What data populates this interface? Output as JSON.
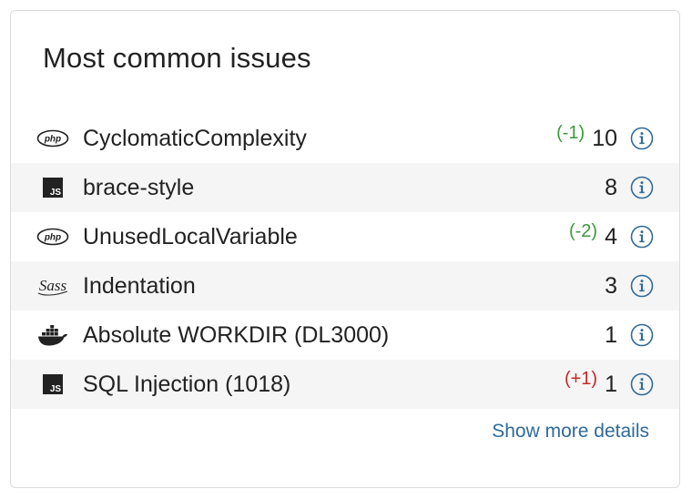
{
  "card": {
    "title": "Most common issues",
    "more_link": "Show more details"
  },
  "issues": [
    {
      "icon": "php-icon",
      "name": "CyclomaticComplexity",
      "delta": "(-1)",
      "delta_type": "down",
      "count": "10"
    },
    {
      "icon": "javascript-icon",
      "name": "brace-style",
      "delta": "",
      "delta_type": "",
      "count": "8"
    },
    {
      "icon": "php-icon",
      "name": "UnusedLocalVariable",
      "delta": "(-2)",
      "delta_type": "down",
      "count": "4"
    },
    {
      "icon": "sass-icon",
      "name": "Indentation",
      "delta": "",
      "delta_type": "",
      "count": "3"
    },
    {
      "icon": "docker-icon",
      "name": "Absolute WORKDIR (DL3000)",
      "delta": "",
      "delta_type": "",
      "count": "1"
    },
    {
      "icon": "javascript-icon",
      "name": "SQL Injection (1018)",
      "delta": "(+1)",
      "delta_type": "up",
      "count": "1"
    }
  ],
  "colors": {
    "improved": "#3b9a3b",
    "worsened": "#c62828",
    "link": "#2f6a9a",
    "info_icon": "#2f6a9a"
  }
}
